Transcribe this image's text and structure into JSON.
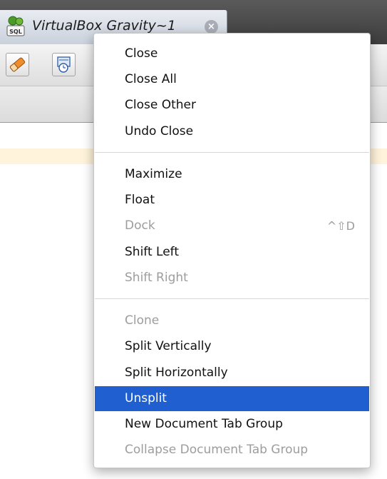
{
  "document_tab": {
    "title": "VirtualBox Gravity~1",
    "icon": "sql-database-icon",
    "icon_label": "SQL",
    "close_icon": "close-circle-icon",
    "close_glyph": "×"
  },
  "toolbar": {
    "buttons": [
      {
        "icon": "eraser-icon"
      },
      {
        "icon": "history-icon"
      }
    ]
  },
  "context_menu": {
    "groups": [
      {
        "items": [
          {
            "label": "Close",
            "enabled": true
          },
          {
            "label": "Close All",
            "enabled": true
          },
          {
            "label": "Close Other",
            "enabled": true
          },
          {
            "label": "Undo Close",
            "enabled": true
          }
        ]
      },
      {
        "items": [
          {
            "label": "Maximize",
            "enabled": true
          },
          {
            "label": "Float",
            "enabled": true
          },
          {
            "label": "Dock",
            "enabled": false,
            "shortcut": "^⇧D"
          },
          {
            "label": "Shift Left",
            "enabled": true
          },
          {
            "label": "Shift Right",
            "enabled": false
          }
        ]
      },
      {
        "items": [
          {
            "label": "Clone",
            "enabled": false
          },
          {
            "label": "Split Vertically",
            "enabled": true
          },
          {
            "label": "Split Horizontally",
            "enabled": true
          },
          {
            "label": "Unsplit",
            "enabled": true,
            "selected": true
          },
          {
            "label": "New Document Tab Group",
            "enabled": true
          },
          {
            "label": "Collapse Document Tab Group",
            "enabled": false
          }
        ]
      }
    ]
  },
  "colors": {
    "selection": "#1f5fcf",
    "disabled_text": "#9d9d9d",
    "editor_line_highlight": "#fff4db"
  }
}
